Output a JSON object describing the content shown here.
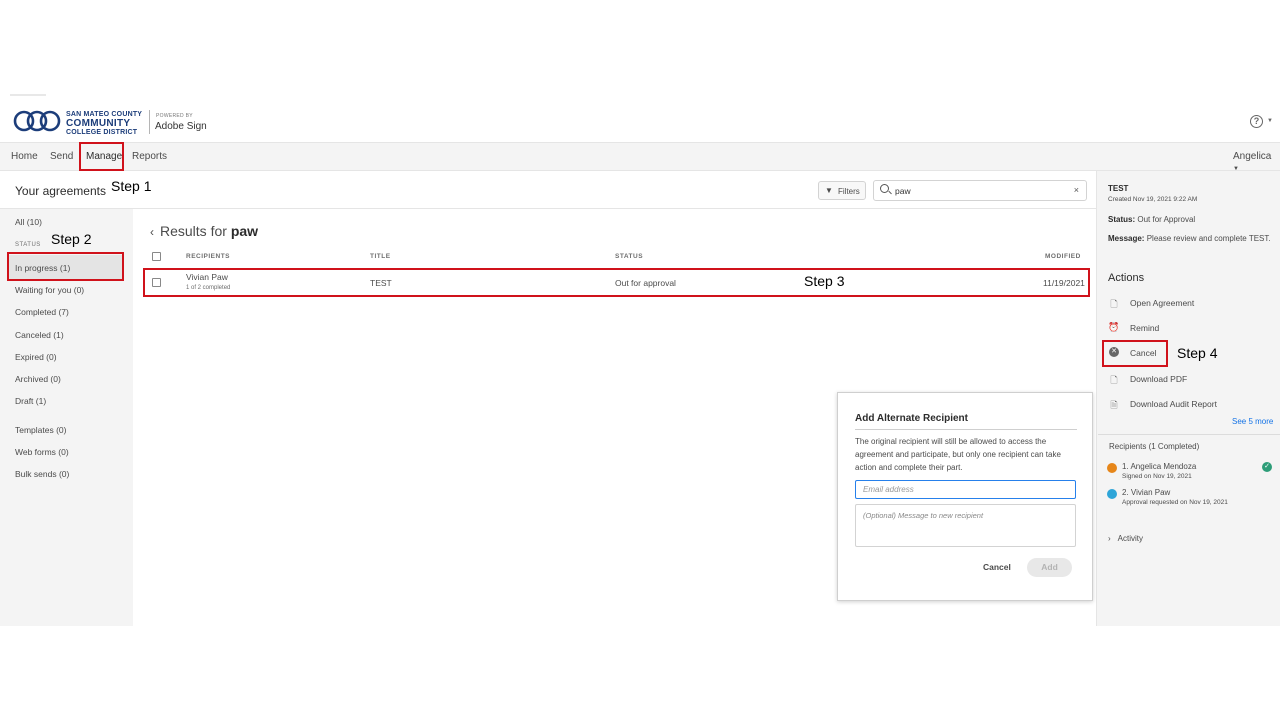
{
  "brand": {
    "logo_line1": "SAN MATEO COUNTY",
    "logo_line2": "COMMUNITY",
    "logo_line3": "COLLEGE DISTRICT",
    "powered_by": "POWERED BY",
    "product": "Adobe Sign",
    "help": "?"
  },
  "nav": {
    "home": "Home",
    "send": "Send",
    "manage": "Manage",
    "reports": "Reports",
    "user": "Angelica"
  },
  "steps": {
    "s1": "Step 1",
    "s2": "Step 2",
    "s3": "Step 3",
    "s4": "Step 4"
  },
  "left": {
    "heading": "Your agreements",
    "all": "All (10)",
    "status_label": "STATUS",
    "items": [
      "In progress (1)",
      "Waiting for you (0)",
      "Completed (7)",
      "Canceled (1)",
      "Expired (0)",
      "Archived (0)",
      "Draft (1)"
    ],
    "other": [
      "Templates (0)",
      "Web forms (0)",
      "Bulk sends (0)"
    ]
  },
  "toolbar": {
    "filters": "Filters",
    "search_value": "paw",
    "clear": "×"
  },
  "results": {
    "prefix": "Results for",
    "query": "paw",
    "columns": [
      "RECIPIENTS",
      "TITLE",
      "STATUS",
      "MODIFIED"
    ],
    "rows": [
      {
        "recipient": "Vivian Paw",
        "progress": "1 of 2 completed",
        "title": "TEST",
        "status": "Out for approval",
        "modified": "11/19/2021"
      }
    ]
  },
  "panel": {
    "title": "TEST",
    "created": "Created Nov 19, 2021 9:22 AM",
    "status_label": "Status:",
    "status_value": "Out for Approval",
    "message_label": "Message:",
    "message_value": "Please review and complete TEST.",
    "actions_heading": "Actions",
    "actions": [
      "Open Agreement",
      "Remind",
      "Cancel",
      "Download PDF",
      "Download Audit Report"
    ],
    "see_more": "See 5 more",
    "recipients_heading": "Recipients (1 Completed)",
    "recipients": [
      {
        "name": "1. Angelica Mendoza",
        "detail": "Signed on Nov 19, 2021"
      },
      {
        "name": "2. Vivian Paw",
        "detail": "Approval requested on Nov 19, 2021"
      }
    ],
    "activity": "Activity"
  },
  "dialog": {
    "title": "Add Alternate Recipient",
    "body": "The original recipient will still be allowed to access the agreement and participate, but only one recipient can take action and complete their part.",
    "email_placeholder": "Email address",
    "message_placeholder": "(Optional) Message to new recipient",
    "cancel": "Cancel",
    "add": "Add"
  },
  "colors": {
    "step_outline": "#d0121b",
    "link": "#1473e6",
    "success": "#2d9d78",
    "recipient1": "#e68619",
    "recipient2": "#2ea5d8"
  }
}
